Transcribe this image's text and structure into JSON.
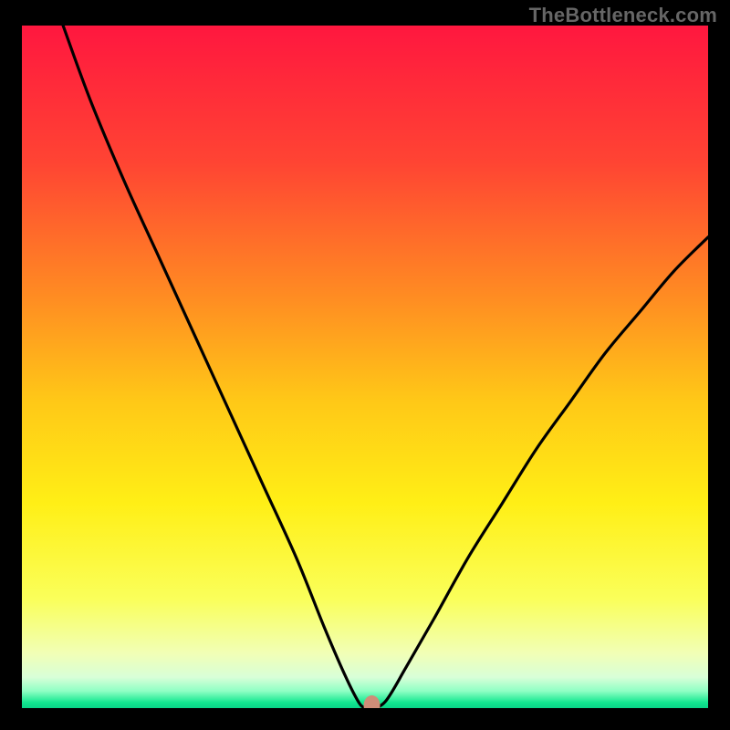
{
  "watermark": "TheBottleneck.com",
  "chart_data": {
    "type": "line",
    "title": "",
    "xlabel": "",
    "ylabel": "",
    "xlim": [
      0,
      100
    ],
    "ylim": [
      0,
      100
    ],
    "grid": false,
    "background_gradient": {
      "stops": [
        {
          "pos": 0.0,
          "color": "#ff173f"
        },
        {
          "pos": 0.2,
          "color": "#ff4433"
        },
        {
          "pos": 0.4,
          "color": "#ff8d22"
        },
        {
          "pos": 0.55,
          "color": "#ffc817"
        },
        {
          "pos": 0.7,
          "color": "#ffef16"
        },
        {
          "pos": 0.84,
          "color": "#faff5a"
        },
        {
          "pos": 0.92,
          "color": "#f1ffb6"
        },
        {
          "pos": 0.955,
          "color": "#d8ffd8"
        },
        {
          "pos": 0.975,
          "color": "#8fffc4"
        },
        {
          "pos": 0.992,
          "color": "#11e78f"
        },
        {
          "pos": 1.0,
          "color": "#0ad488"
        }
      ]
    },
    "series": [
      {
        "name": "bottleneck-curve",
        "note": "y = bottleneck percentage (approx); x = relative component balance axis; curve reaches ~0 near x≈50",
        "x": [
          6,
          10,
          15,
          20,
          25,
          30,
          35,
          40,
          44,
          47,
          49,
          50,
          51,
          53,
          56,
          60,
          65,
          70,
          75,
          80,
          85,
          90,
          95,
          100
        ],
        "y": [
          100,
          89,
          77,
          66,
          55,
          44,
          33,
          22,
          12,
          5,
          1,
          0,
          0,
          1,
          6,
          13,
          22,
          30,
          38,
          45,
          52,
          58,
          64,
          69
        ]
      }
    ],
    "marker": {
      "name": "optimal-point",
      "x": 51,
      "y": 0,
      "color": "#cf8d78"
    }
  }
}
